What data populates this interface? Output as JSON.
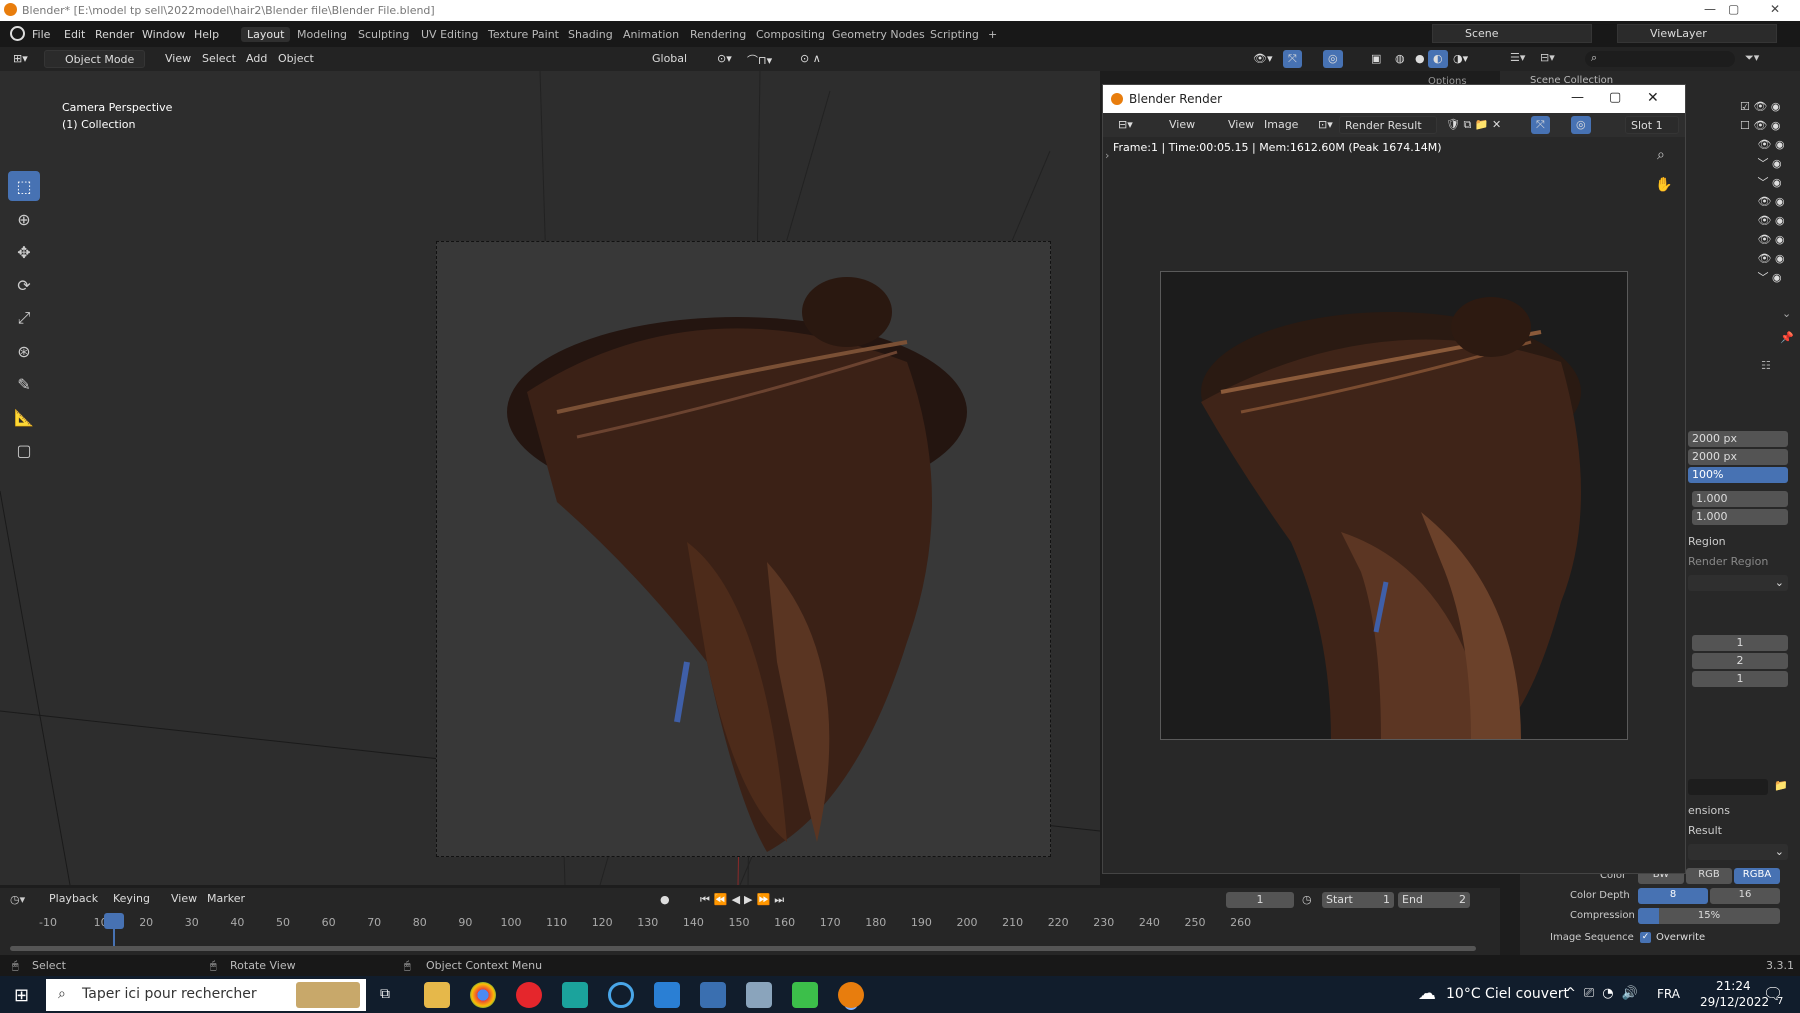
{
  "window": {
    "title": "Blender* [E:\\model tp sell\\2022model\\hair2\\Blender file\\Blender File.blend]",
    "min": "—",
    "max": "▢",
    "close": "✕"
  },
  "menu": [
    "File",
    "Edit",
    "Render",
    "Window",
    "Help"
  ],
  "workspaces": [
    "Layout",
    "Modeling",
    "Sculpting",
    "UV Editing",
    "Texture Paint",
    "Shading",
    "Animation",
    "Rendering",
    "Compositing",
    "Geometry Nodes",
    "Scripting",
    "+"
  ],
  "scene": {
    "label": "Scene",
    "viewlayer": "ViewLayer"
  },
  "header": {
    "mode": "Object Mode",
    "menus": [
      "View",
      "Select",
      "Add",
      "Object"
    ],
    "orientation": "Global",
    "options": "Options"
  },
  "viewport": {
    "perspective": "Camera Perspective",
    "collection": "(1) Collection"
  },
  "outliner": {
    "scene_collection": "Scene Collection"
  },
  "render_window": {
    "title": "Blender Render",
    "menus": [
      "View",
      "View",
      "Image"
    ],
    "result_name": "Render Result",
    "slot": "Slot 1",
    "stats": "Frame:1 | Time:00:05.15 | Mem:1612.60M (Peak 1674.14M)"
  },
  "properties": {
    "res_x": "2000 px",
    "res_y": "2000 px",
    "res_percent": "100%",
    "aspect_x": "1.000",
    "aspect_y": "1.000",
    "region": "Region",
    "render_region": "Render Region",
    "frame_start": "1",
    "frame_end": "2",
    "frame_step": "1",
    "dimensions_partial": "ensions",
    "result_partial": "Result",
    "color_label": "Color",
    "color_opts": [
      "BW",
      "RGB",
      "RGBA"
    ],
    "color_depth_label": "Color Depth",
    "color_depth_opts": [
      "8",
      "16"
    ],
    "compression_label": "Compression",
    "compression": "15%",
    "compression_fraction": 0.15,
    "image_sequence_label": "Image Sequence",
    "overwrite": "Overwrite"
  },
  "timeline": {
    "menus": [
      "Playback",
      "Keying",
      "View",
      "Marker"
    ],
    "current_frame": "1",
    "start_label": "Start",
    "start": "1",
    "end_label": "End",
    "end": "2",
    "ticks": [
      "-10",
      "1",
      "10",
      "20",
      "30",
      "40",
      "50",
      "60",
      "70",
      "80",
      "90",
      "100",
      "110",
      "120",
      "130",
      "140",
      "150",
      "160",
      "170",
      "180",
      "190",
      "200",
      "210",
      "220",
      "230",
      "240",
      "250",
      "260"
    ]
  },
  "statusbar": {
    "select": "Select",
    "rotate": "Rotate View",
    "context": "Object Context Menu",
    "version": "3.3.1"
  },
  "taskbar": {
    "search_placeholder": "Taper ici pour rechercher",
    "weather": "10°C  Ciel couvert",
    "lang": "FRA",
    "time": "21:24",
    "date": "29/12/2022",
    "notif": "7"
  },
  "colors": {
    "accent": "#4772b3",
    "bg": "#2d2d2d",
    "hair": "#5a3522"
  }
}
